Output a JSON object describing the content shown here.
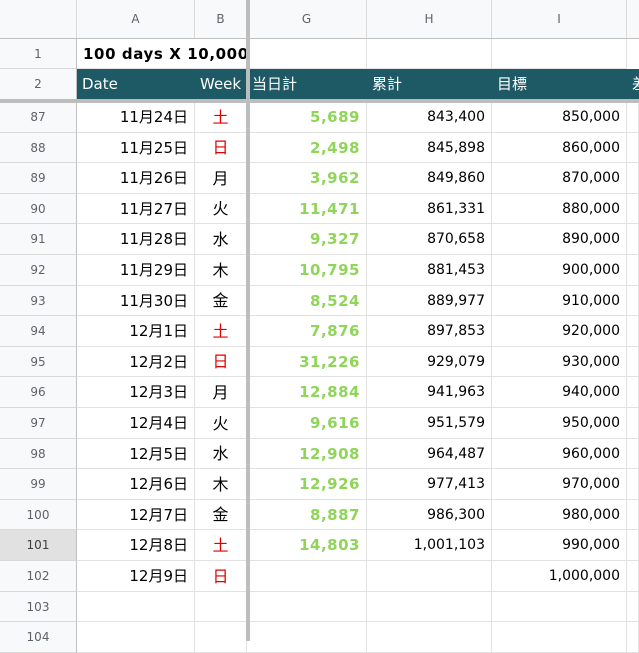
{
  "columns": [
    {
      "id": "A",
      "label": "A"
    },
    {
      "id": "B",
      "label": "B"
    },
    {
      "id": "G",
      "label": "G"
    },
    {
      "id": "H",
      "label": "H"
    },
    {
      "id": "I",
      "label": "I"
    }
  ],
  "title_row": {
    "num": "1",
    "text": "100 days X 10,000"
  },
  "header_row": {
    "num": "2",
    "date": "Date",
    "week": "Week",
    "daily": "当日計",
    "cumulative": "累計",
    "target": "目標",
    "next": "差"
  },
  "selected_row": "101",
  "colors": {
    "header_bg": "#1e5a66",
    "daily_green": "#8fd55a",
    "weekend_red": "#e00000"
  },
  "rows": [
    {
      "num": "87",
      "date": "11月24日",
      "week": "土",
      "weekend": true,
      "daily": "5,689",
      "cumulative": "843,400",
      "target": "850,000"
    },
    {
      "num": "88",
      "date": "11月25日",
      "week": "日",
      "weekend": true,
      "daily": "2,498",
      "cumulative": "845,898",
      "target": "860,000"
    },
    {
      "num": "89",
      "date": "11月26日",
      "week": "月",
      "weekend": false,
      "daily": "3,962",
      "cumulative": "849,860",
      "target": "870,000"
    },
    {
      "num": "90",
      "date": "11月27日",
      "week": "火",
      "weekend": false,
      "daily": "11,471",
      "cumulative": "861,331",
      "target": "880,000"
    },
    {
      "num": "91",
      "date": "11月28日",
      "week": "水",
      "weekend": false,
      "daily": "9,327",
      "cumulative": "870,658",
      "target": "890,000"
    },
    {
      "num": "92",
      "date": "11月29日",
      "week": "木",
      "weekend": false,
      "daily": "10,795",
      "cumulative": "881,453",
      "target": "900,000"
    },
    {
      "num": "93",
      "date": "11月30日",
      "week": "金",
      "weekend": false,
      "daily": "8,524",
      "cumulative": "889,977",
      "target": "910,000"
    },
    {
      "num": "94",
      "date": "12月1日",
      "week": "土",
      "weekend": true,
      "daily": "7,876",
      "cumulative": "897,853",
      "target": "920,000"
    },
    {
      "num": "95",
      "date": "12月2日",
      "week": "日",
      "weekend": true,
      "daily": "31,226",
      "cumulative": "929,079",
      "target": "930,000"
    },
    {
      "num": "96",
      "date": "12月3日",
      "week": "月",
      "weekend": false,
      "daily": "12,884",
      "cumulative": "941,963",
      "target": "940,000"
    },
    {
      "num": "97",
      "date": "12月4日",
      "week": "火",
      "weekend": false,
      "daily": "9,616",
      "cumulative": "951,579",
      "target": "950,000"
    },
    {
      "num": "98",
      "date": "12月5日",
      "week": "水",
      "weekend": false,
      "daily": "12,908",
      "cumulative": "964,487",
      "target": "960,000"
    },
    {
      "num": "99",
      "date": "12月6日",
      "week": "木",
      "weekend": false,
      "daily": "12,926",
      "cumulative": "977,413",
      "target": "970,000"
    },
    {
      "num": "100",
      "date": "12月7日",
      "week": "金",
      "weekend": false,
      "daily": "8,887",
      "cumulative": "986,300",
      "target": "980,000"
    },
    {
      "num": "101",
      "date": "12月8日",
      "week": "土",
      "weekend": true,
      "daily": "14,803",
      "cumulative": "1,001,103",
      "target": "990,000"
    },
    {
      "num": "102",
      "date": "12月9日",
      "week": "日",
      "weekend": true,
      "daily": "",
      "cumulative": "",
      "target": "1,000,000"
    },
    {
      "num": "103",
      "date": "",
      "week": "",
      "weekend": false,
      "daily": "",
      "cumulative": "",
      "target": ""
    },
    {
      "num": "104",
      "date": "",
      "week": "",
      "weekend": false,
      "daily": "",
      "cumulative": "",
      "target": ""
    }
  ]
}
